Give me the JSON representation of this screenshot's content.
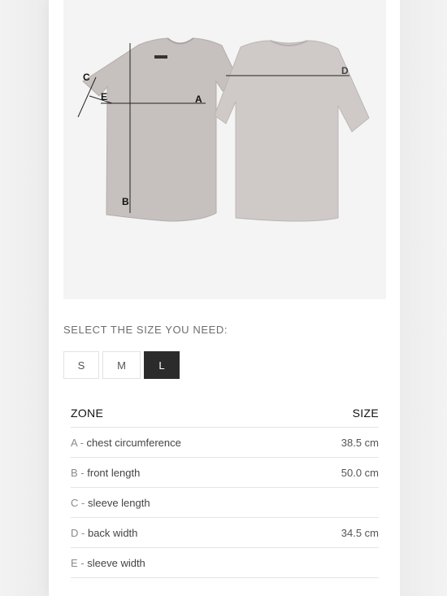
{
  "figure": {
    "labels": {
      "a": "A",
      "b": "B",
      "c": "C",
      "d": "D",
      "e": "E"
    }
  },
  "size_selector": {
    "prompt": "SELECT THE SIZE YOU NEED:",
    "options": [
      "S",
      "M",
      "L"
    ],
    "selected": "L"
  },
  "size_table": {
    "headers": {
      "zone": "ZONE",
      "size": "SIZE"
    },
    "rows": [
      {
        "letter": "A -",
        "zone": "chest circumference",
        "value": "38.5 cm"
      },
      {
        "letter": "B -",
        "zone": "front length",
        "value": "50.0 cm"
      },
      {
        "letter": "C -",
        "zone": "sleeve length",
        "value": ""
      },
      {
        "letter": "D -",
        "zone": "back width",
        "value": "34.5 cm"
      },
      {
        "letter": "E -",
        "zone": "sleeve width",
        "value": ""
      }
    ]
  },
  "colors": {
    "selected_bg": "#2b2b2b",
    "shirt": "#c9c4c1",
    "panel": "#f4f4f4"
  }
}
